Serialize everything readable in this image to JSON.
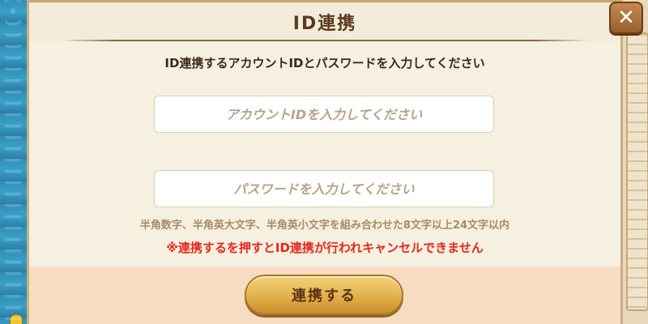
{
  "dialog": {
    "title": "ID連携",
    "instruction": "ID連携するアカウントIDとパスワードを入力してください",
    "close_icon": "close-icon"
  },
  "form": {
    "account_id": {
      "value": "",
      "placeholder": "アカウントIDを入力してください"
    },
    "password": {
      "value": "",
      "placeholder": "パスワードを入力してください"
    },
    "password_rule": "半角数字、半角英大文字、半角英小文字を組み合わせた8文字以上24文字以内",
    "warning": "※連携するを押すとID連携が行われキャンセルできません"
  },
  "footer": {
    "submit_label": "連携する"
  },
  "colors": {
    "warning": "#e8261b",
    "button": "#e2b04a",
    "panel": "#f6f0e1"
  }
}
